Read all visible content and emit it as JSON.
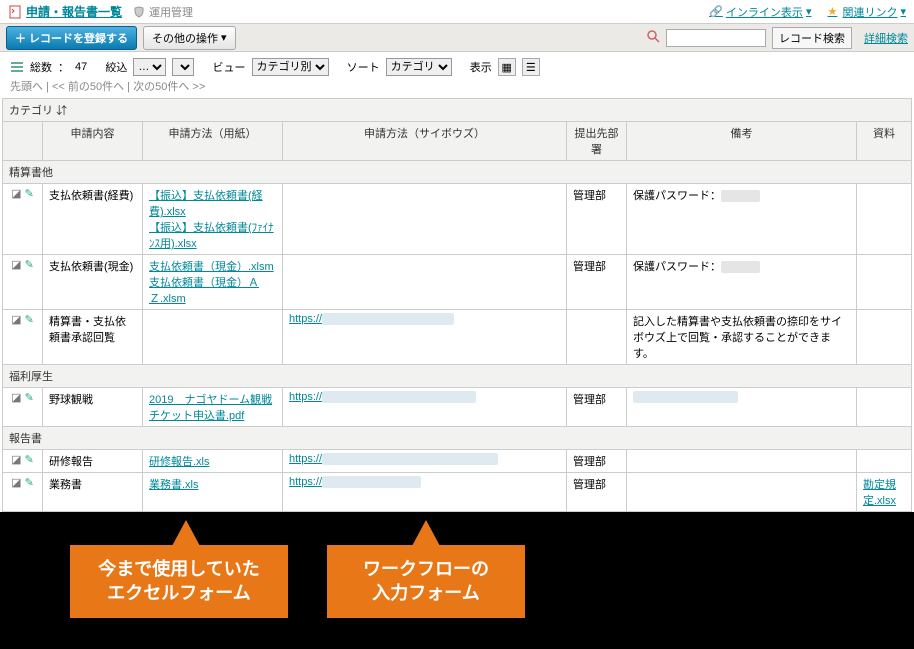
{
  "header": {
    "title": "申請・報告書一覧",
    "management": "運用管理",
    "inlineView": "インライン表示",
    "relatedLinks": "関連リンク"
  },
  "toolbar": {
    "register": "レコードを登録する",
    "otherOps": "その他の操作",
    "recordSearch": "レコード検索",
    "detailSearch": "詳細検索"
  },
  "controls": {
    "totalLabel": "総数",
    "totalCount": "47",
    "filterLabel": "絞込",
    "filterSel": "…",
    "viewLabel": "ビュー",
    "viewSel": "カテゴリ別",
    "sortLabel": "ソート",
    "sortSel": "カテゴリ",
    "displayLabel": "表示"
  },
  "pager": {
    "top": "先頭へ",
    "prev": "<< 前の50件へ",
    "next": "次の50件へ >>"
  },
  "table": {
    "catHeader": "カテゴリ",
    "cols": [
      "",
      "申請内容",
      "申請方法（用紙）",
      "申請方法（サイボウズ）",
      "提出先部署",
      "備考",
      "資料"
    ],
    "groups": [
      {
        "name": "精算書他",
        "rows": [
          {
            "c2": "支払依頼書(経費)",
            "c3a": "【振込】支払依頼書(経費).xlsx",
            "c3b": "【振込】支払依頼書(ﾌｧｲﾅﾝｽ用).xlsx",
            "c4": "",
            "c5": "管理部",
            "c6": "保護パスワード：",
            "c6blur": "xxxxxxx",
            "c7": ""
          },
          {
            "c2": "支払依頼書(現金)",
            "c3a": "支払依頼書（現金）.xlsm",
            "c3b": "支払依頼書（現金）ＡＺ.xlsm",
            "c4": "",
            "c5": "管理部",
            "c6": "保護パスワード：",
            "c6blur": "xxxxxxx",
            "c7": ""
          },
          {
            "c2": "精算書・支払依頼書承認回覧",
            "c3a": "",
            "c3b": "",
            "c4": "https://",
            "c4blur": "xxxxxxxxxxxxxxxxxxxxxxxx",
            "c5": "",
            "c6": "記入した精算書や支払依頼書の捺印をサイボウズ上で回覧・承認することができます。",
            "c7": ""
          }
        ]
      },
      {
        "name": "福利厚生",
        "rows": [
          {
            "c2": "野球観戦",
            "c3a": "2019　ナゴヤドーム観戦チケット申込書.pdf",
            "c3b": "",
            "c4": "https://",
            "c4blur": "xxxxxxxxxxxxxxxxxxxxxxxxxxxx",
            "c5": "管理部",
            "c6": "",
            "c6blurlink": "xxxxxxxxxxxxxxxxxxx",
            "c7": ""
          }
        ]
      },
      {
        "name": "報告書",
        "rows": [
          {
            "c2": "研修報告",
            "c3a": "研修報告.xls",
            "c3b": "",
            "c4": "https://",
            "c4blur": "xxxxxxxxxxxxxxxxxxxxxxxxxxxxxxxx",
            "c5": "管理部",
            "c6": "",
            "c7": ""
          },
          {
            "c2": "業務書",
            "c3a": "業務書.xls",
            "c3b": "",
            "c4": "https://",
            "c4blur": "xxxxxxxxxxxxxxxxxx",
            "c5": "管理部",
            "c6": "",
            "c7": "勘定規定.xlsx"
          }
        ]
      }
    ]
  },
  "annot": {
    "left": "今まで使用していた\nエクセルフォーム",
    "right": "ワークフローの\n入力フォーム"
  }
}
